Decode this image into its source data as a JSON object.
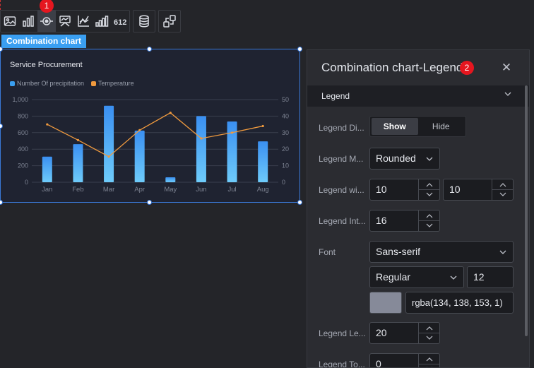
{
  "toolbar": {
    "badge": "1",
    "icons": [
      "image-icon",
      "bar-chart-icon",
      "combination-chart-icon",
      "screen-icon",
      "axis-chart-icon",
      "ascending-bar-icon",
      "number-icon",
      "database-icon",
      "interaction-icon"
    ]
  },
  "chart_tag": "Combination chart",
  "chart_data": {
    "type": "bar",
    "title": "Service Procurement",
    "categories": [
      "Jan",
      "Feb",
      "Mar",
      "Apr",
      "May",
      "Jun",
      "Jul",
      "Aug"
    ],
    "series": [
      {
        "name": "Number Of precipitation",
        "type": "bar",
        "axis": "left",
        "values": [
          310,
          460,
          925,
          625,
          60,
          800,
          735,
          495
        ],
        "color": "#3a9ff1"
      },
      {
        "name": "Temperature",
        "type": "line",
        "axis": "right",
        "values": [
          35,
          25.5,
          15.5,
          31.5,
          42,
          26.5,
          30,
          34
        ],
        "color": "#f09a3e"
      }
    ],
    "y_left": {
      "min": 0,
      "max": 1000,
      "ticks": [
        "0",
        "200",
        "400",
        "600",
        "800",
        "1,000"
      ]
    },
    "y_right": {
      "min": 0,
      "max": 50,
      "ticks": [
        "0",
        "10",
        "20",
        "30",
        "40",
        "50"
      ]
    },
    "grid": true,
    "legend_position": "top-left"
  },
  "panel": {
    "title": "Combination chart-Legend",
    "badge": "2",
    "section": "Legend",
    "display_label": "Legend Di...",
    "display_options": [
      "Show",
      "Hide"
    ],
    "marker_label": "Legend M...",
    "marker_value": "Rounded",
    "width_label": "Legend wi...",
    "width_value": "10",
    "height_value": "10",
    "interval_label": "Legend Int...",
    "interval_value": "16",
    "font_label": "Font",
    "font_family": "Sans-serif",
    "font_weight": "Regular",
    "font_size": "12",
    "font_color": "rgba(134, 138, 153, 1)",
    "left_label": "Legend Le...",
    "left_value": "20",
    "top_label": "Legend To...",
    "top_value": "0"
  }
}
